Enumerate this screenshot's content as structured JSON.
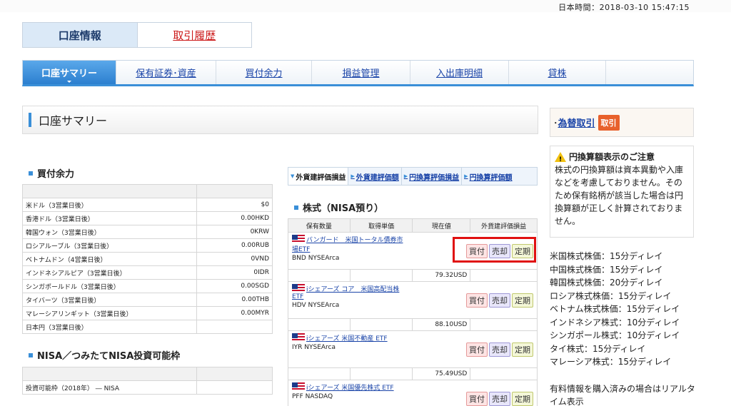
{
  "clock": "日本時間：2018-03-10 15:47:15",
  "top_tabs": {
    "account": "口座情報",
    "history": "取引履歴"
  },
  "nav": [
    "口座サマリー",
    "保有証券･資産",
    "買付余力",
    "損益管理",
    "入出庫明細",
    "貸株"
  ],
  "page_title": "口座サマリー",
  "buying_power": {
    "title": "買付余力",
    "rows": [
      {
        "label": "米ドル（3営業日後）",
        "value": "$0"
      },
      {
        "label": "香港ドル（3営業日後）",
        "value": "0.00HKD"
      },
      {
        "label": "韓国ウォン（3営業日後）",
        "value": "0KRW"
      },
      {
        "label": "ロシアルーブル（3営業日後）",
        "value": "0.00RUB"
      },
      {
        "label": "ベトナムドン（4営業日後）",
        "value": "0VND"
      },
      {
        "label": "インドネシアルピア（3営業日後）",
        "value": "0IDR"
      },
      {
        "label": "シンガポールドル（3営業日後）",
        "value": "0.00SGD"
      },
      {
        "label": "タイバーツ（3営業日後）",
        "value": "0.00THB"
      },
      {
        "label": "マレーシアリンギット（3営業日後）",
        "value": "0.00MYR"
      },
      {
        "label": "日本円（3営業日後）",
        "value": ""
      }
    ]
  },
  "nisa": {
    "title": "NISA／つみたてNISA投資可能枠",
    "row_label": "投資可能枠（2018年） ― NISA"
  },
  "eval_tabs": [
    "外貨建評価損益",
    "外貨建評価額",
    "円換算評価損益",
    "円換算評価額"
  ],
  "stocks": {
    "title": "株式（NISA預り）",
    "headers": [
      "保有数量",
      "取得単価",
      "現在値",
      "外貨建評価損益"
    ],
    "buttons": {
      "buy": "買付",
      "sell": "売却",
      "regular": "定期"
    },
    "items": [
      {
        "name": "バンガード　米国トータル債券市場ETF",
        "exchange": "BND NYSEArca",
        "price": "79.32USD"
      },
      {
        "name": "iシェアーズ コア　米国高配当株ETF",
        "exchange": "HDV NYSEArca",
        "price": "88.10USD"
      },
      {
        "name": "iシェアーズ 米国不動産 ETF",
        "exchange": "IYR NYSEArca",
        "price": "75.49USD"
      },
      {
        "name": "iシェアーズ 米国優先株式 ETF",
        "exchange": "PFF NASDAQ",
        "price": ""
      }
    ]
  },
  "fx": {
    "link": "為替取引",
    "button": "取引"
  },
  "notice": {
    "title": "円換算額表示のご注意",
    "body": "株式の円換算額は資本異動や入庫などを考慮しておりません。そのため保有銘柄が該当した場合は円換算額が正しく計算されておりません。"
  },
  "delays": [
    "米国株式株価：15分ディレイ",
    "中国株式株価：15分ディレイ",
    "韓国株式株価：20分ディレイ",
    "ロシア株式株価：15分ディレイ",
    "ベトナム株式株価：15分ディレイ",
    "インドネシア株式：10分ディレイ",
    "シンガポール株式：10分ディレイ",
    "タイ株式：15分ディレイ",
    "マレーシア株式：15分ディレイ"
  ],
  "paid_note": "有料情報を購入済みの場合はリアルタイム表示"
}
